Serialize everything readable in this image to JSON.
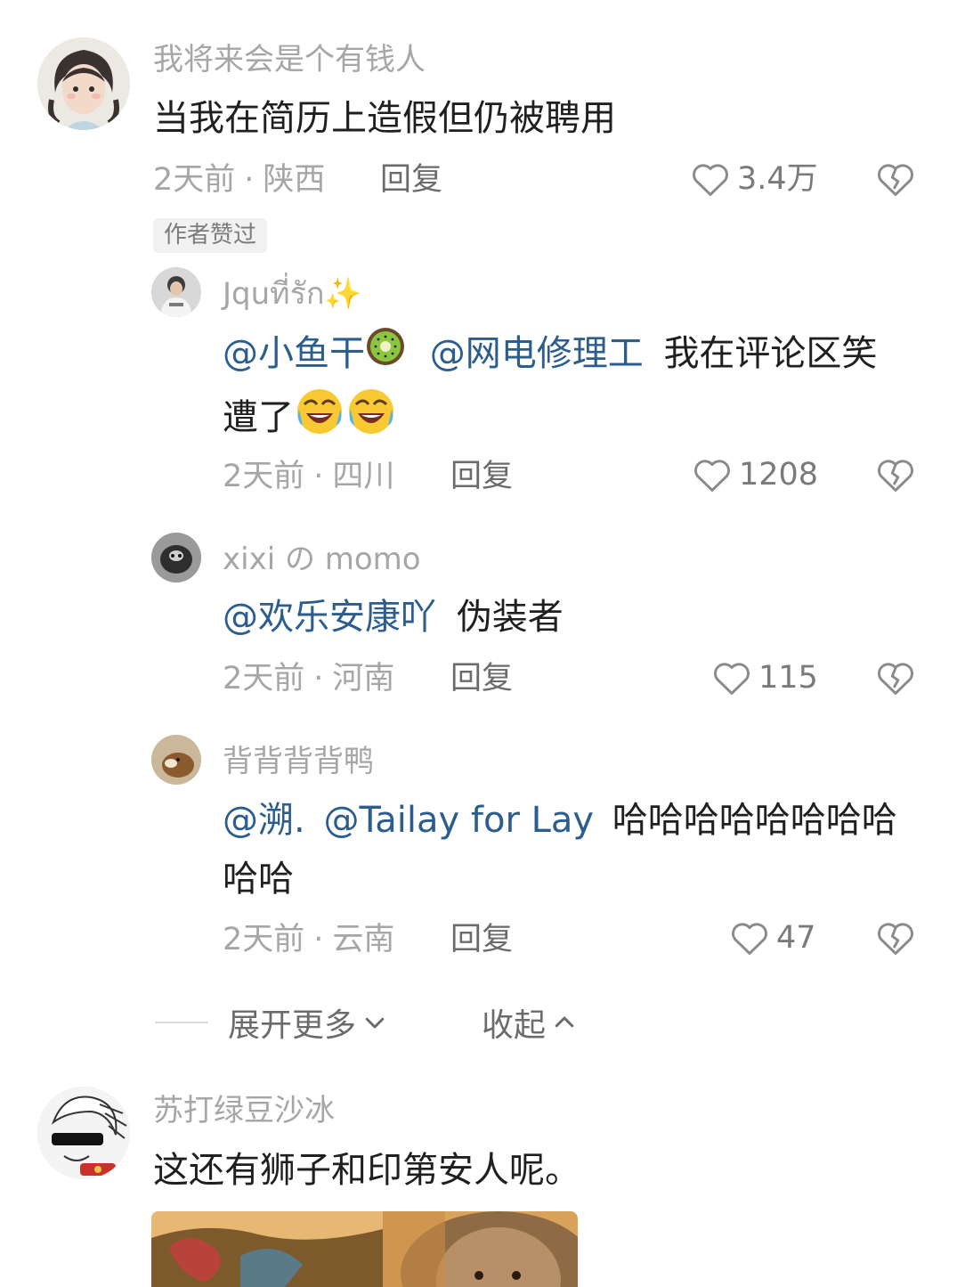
{
  "comments": [
    {
      "username": "我将来会是个有钱人",
      "text": "当我在简历上造假但仍被聘用",
      "time": "2天前",
      "location": "陕西",
      "reply_label": "回复",
      "likes": "3.4万",
      "badge": "作者赞过"
    },
    {
      "username": "Jquที่รัก",
      "username_emoji": "sparkles-icon",
      "mentions": [
        "@小鱼干",
        "@网电修理工"
      ],
      "text_after": "我在评论区笑",
      "text_line2": "遭了",
      "time": "2天前",
      "location": "四川",
      "reply_label": "回复",
      "likes": "1208"
    },
    {
      "username": "xixi の momo",
      "mentions": [
        "@欢乐安康吖"
      ],
      "text_after": "伪装者",
      "time": "2天前",
      "location": "河南",
      "reply_label": "回复",
      "likes": "115"
    },
    {
      "username": "背背背背鸭",
      "mentions": [
        "@溯.",
        "@Tailay for Lay"
      ],
      "text_after": "哈哈哈哈哈哈哈哈",
      "text_line2": "哈哈",
      "time": "2天前",
      "location": "云南",
      "reply_label": "回复",
      "likes": "47"
    },
    {
      "username": "苏打绿豆沙冰",
      "text": "这还有狮子和印第安人呢。"
    }
  ],
  "thread_controls": {
    "expand_label": "展开更多",
    "collapse_label": "收起"
  },
  "colors": {
    "mention": "#2b5d8f",
    "muted": "#a6a6a6",
    "text": "#1f1f1f"
  }
}
